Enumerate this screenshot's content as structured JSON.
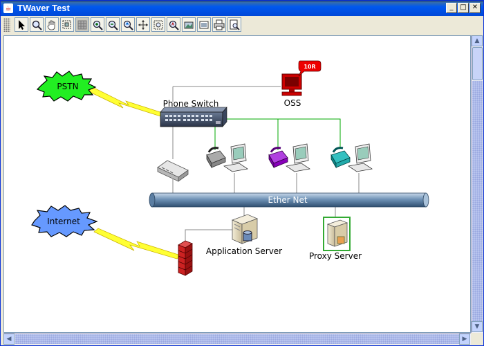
{
  "window": {
    "title": "TWaver Test",
    "controls": {
      "minimize": "_",
      "maximize": "□",
      "close": "✕"
    }
  },
  "toolbar": {
    "buttons": [
      {
        "name": "select-tool-button",
        "icon": "arrow-pointer-icon"
      },
      {
        "name": "magnifier-tool-button",
        "icon": "magnifier-icon"
      },
      {
        "name": "pan-tool-button",
        "icon": "hand-icon"
      },
      {
        "name": "rubberband-zoom-button",
        "icon": "zoom-rect-icon"
      },
      {
        "name": "disabled-tool-button",
        "icon": "grid-icon"
      },
      {
        "name": "zoom-in-button",
        "icon": "zoom-in-icon"
      },
      {
        "name": "zoom-out-button",
        "icon": "zoom-out-icon"
      },
      {
        "name": "zoom-reset-button",
        "icon": "zoom-home-icon"
      },
      {
        "name": "zoom-fit-button",
        "icon": "fit-arrows-icon"
      },
      {
        "name": "zoom-overview-button",
        "icon": "overview-icon"
      },
      {
        "name": "zoom-search-button",
        "icon": "zoom-search-icon"
      },
      {
        "name": "export-image-button",
        "icon": "image-export-icon"
      },
      {
        "name": "fullscreen-button",
        "icon": "fullscreen-icon"
      },
      {
        "name": "print-button",
        "icon": "printer-icon"
      },
      {
        "name": "print-preview-button",
        "icon": "print-preview-icon"
      }
    ]
  },
  "diagram": {
    "nodes": {
      "pstn": "PSTN",
      "internet": "Internet",
      "phone_switch": "Phone Switch",
      "oss": "OSS",
      "oss_alarm_badge": "10R",
      "ether_net": "Ether Net",
      "application_server": "Application Server",
      "proxy_server": "Proxy Server"
    },
    "colors": {
      "pstn_cloud": "#22ee22",
      "internet_cloud": "#6699ff",
      "lightning": "#ffff33",
      "green_link": "#00aa00",
      "gray_link": "#888888",
      "bus": "#7a9cc0",
      "oss_red": "#cc0000",
      "firewall": "#cc2222",
      "proxy_selection": "#33aa33",
      "phone_gray": "#999999",
      "phone_purple": "#9900cc",
      "phone_teal": "#22aaaa"
    }
  }
}
